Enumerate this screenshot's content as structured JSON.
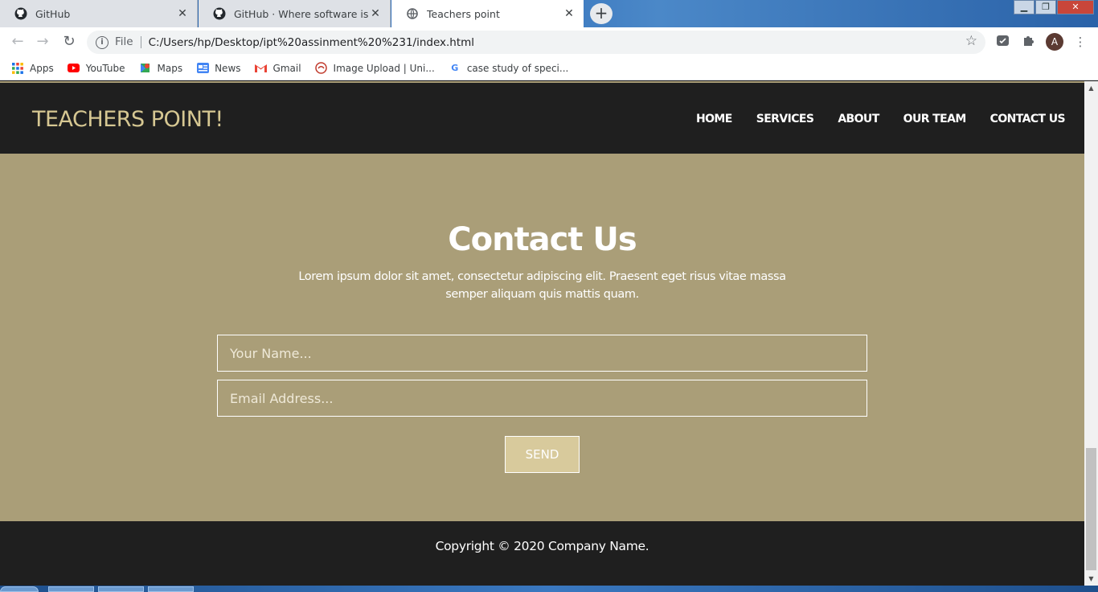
{
  "browser": {
    "tabs": [
      {
        "title": "GitHub",
        "icon": "github-icon"
      },
      {
        "title": "GitHub · Where software is built",
        "icon": "github-icon"
      },
      {
        "title": "Teachers point",
        "icon": "globe-icon",
        "active": true
      }
    ],
    "new_tab_label": "+",
    "url_scheme": "File",
    "url": "C:/Users/hp/Desktop/ipt%20assinment%20%231/index.html",
    "profile_initial": "A",
    "bookmarks": [
      {
        "label": "Apps",
        "icon": "apps-grid-icon"
      },
      {
        "label": "YouTube",
        "icon": "youtube-icon"
      },
      {
        "label": "Maps",
        "icon": "maps-icon"
      },
      {
        "label": "News",
        "icon": "news-icon"
      },
      {
        "label": "Gmail",
        "icon": "gmail-icon"
      },
      {
        "label": "Image Upload | Uni...",
        "icon": "image-upload-icon"
      },
      {
        "label": "case study of speci...",
        "icon": "google-icon"
      }
    ]
  },
  "site": {
    "logo": "TEACHERS POINT!",
    "nav": [
      "HOME",
      "SERVICES",
      "ABOUT",
      "OUR TEAM",
      "CONTACT US"
    ],
    "contact": {
      "title": "Contact Us",
      "description": "Lorem ipsum dolor sit amet, consectetur adipiscing elit. Praesent eget risus vitae massa semper aliquam quis mattis quam.",
      "name_placeholder": "Your Name...",
      "email_placeholder": "Email Address...",
      "send_label": "SEND"
    },
    "footer": {
      "copyright": "Copyright © 2020 Company Name."
    }
  },
  "colors": {
    "header_bg": "#1f1f1f",
    "section_bg": "#aa9e78",
    "logo": "#d6c792",
    "button_bg": "#d8ca9c"
  }
}
